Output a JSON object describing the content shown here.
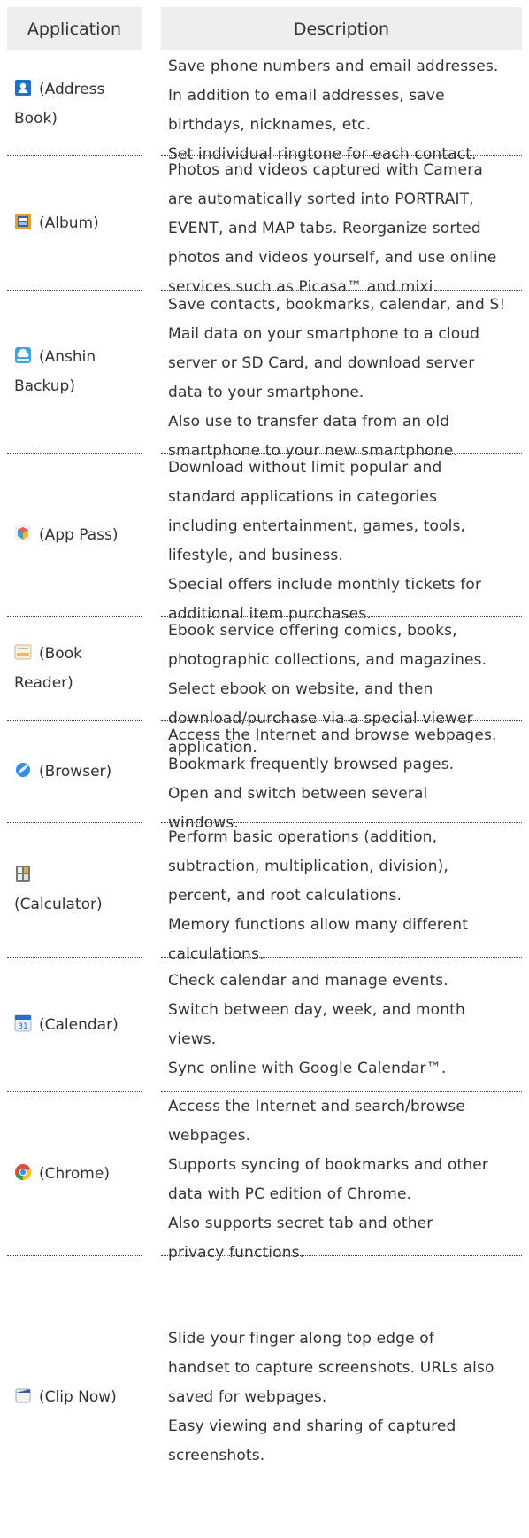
{
  "header": {
    "application": "Application",
    "description": "Description"
  },
  "rows": [
    {
      "app_lines": [
        "(Address",
        "Book)"
      ],
      "icon": "address-book-icon",
      "desc_lines": [
        "Save phone numbers and email addresses.",
        "In addition to email addresses, save",
        "birthdays, nicknames, etc.",
        "Set individual ringtone for each contact."
      ]
    },
    {
      "app_lines": [
        "(Album)"
      ],
      "icon": "album-icon",
      "desc_lines": [
        "Photos and videos captured with Camera",
        "are automatically sorted into PORTRAIT,",
        "EVENT, and MAP tabs. Reorganize sorted",
        "photos and videos yourself, and use online",
        "services such as Picasa™ and mixi."
      ]
    },
    {
      "app_lines": [
        "(Anshin",
        "Backup)"
      ],
      "icon": "anshin-backup-icon",
      "desc_lines": [
        "Save contacts, bookmarks, calendar, and S!",
        "Mail data on your smartphone to a cloud",
        "server or SD Card, and download server",
        "data to your smartphone.",
        "Also use to transfer data from an old",
        "smartphone to your new smartphone."
      ]
    },
    {
      "app_lines": [
        "(App Pass)"
      ],
      "icon": "app-pass-icon",
      "desc_lines": [
        "Download without limit popular and",
        "standard applications in categories",
        "including entertainment, games, tools,",
        "lifestyle, and business.",
        "Special offers include monthly tickets for",
        "additional item purchases."
      ]
    },
    {
      "app_lines": [
        "(Book",
        "Reader)"
      ],
      "icon": "book-reader-icon",
      "desc_lines": [
        "Ebook service offering comics, books,",
        "photographic collections, and magazines.",
        "Select ebook on website, and then",
        "download/purchase via a special viewer",
        "application."
      ]
    },
    {
      "app_lines": [
        "(Browser)"
      ],
      "icon": "browser-icon",
      "desc_lines": [
        "Access the Internet and browse webpages.",
        "Bookmark frequently browsed pages.",
        "Open and switch between several",
        "windows."
      ]
    },
    {
      "app_lines": [
        "",
        "(Calculator)"
      ],
      "icon": "calculator-icon",
      "desc_lines": [
        "Perform basic operations (addition,",
        "subtraction, multiplication, division),",
        "percent, and root calculations.",
        "Memory functions allow many different",
        "calculations."
      ]
    },
    {
      "app_lines": [
        "(Calendar)"
      ],
      "icon": "calendar-icon",
      "desc_lines": [
        "Check calendar and manage events.",
        "Switch between day, week, and month",
        "views.",
        "Sync online with Google Calendar™."
      ]
    },
    {
      "app_lines": [
        "(Chrome)"
      ],
      "icon": "chrome-icon",
      "desc_lines": [
        "Access the Internet and search/browse",
        "webpages.",
        "Supports syncing of bookmarks and other",
        "data with PC edition of Chrome.",
        "Also supports secret tab and other",
        "privacy functions."
      ]
    },
    {
      "app_lines": [
        "(Clip Now)"
      ],
      "icon": "clip-now-icon",
      "desc_lines": [
        "Slide your finger along top edge of",
        "handset to capture screenshots. URLs also",
        "saved for webpages.",
        "Easy viewing and sharing of captured",
        "screenshots."
      ]
    }
  ]
}
